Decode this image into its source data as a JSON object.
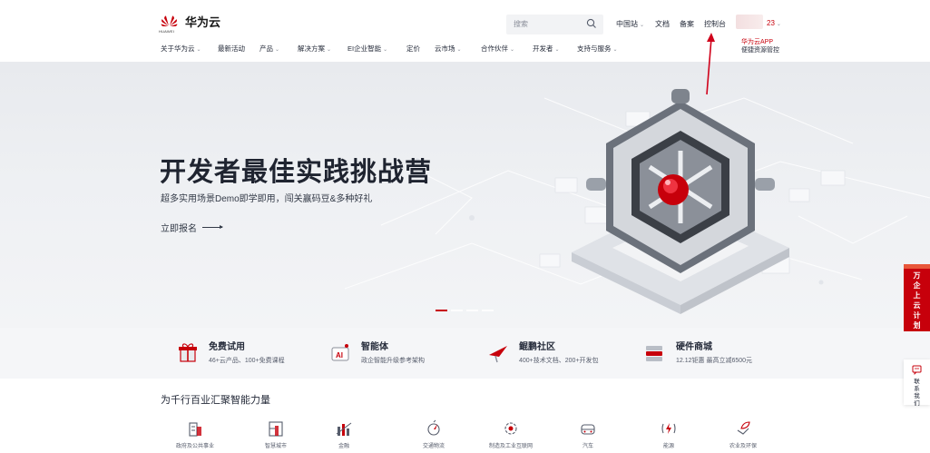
{
  "header": {
    "logo_text": "华为云",
    "logo_sub": "HUAWEI",
    "search_placeholder": "搜索",
    "top_links": {
      "region": "中国站",
      "docs": "文档",
      "filing": "备案",
      "console": "控制台",
      "user_suffix": "23"
    },
    "app_promo": {
      "line1": "华为云APP",
      "line2": "便捷资源管控"
    }
  },
  "nav": [
    {
      "label": "关于华为云",
      "dropdown": true
    },
    {
      "label": "最新活动",
      "dropdown": false
    },
    {
      "label": "产品",
      "dropdown": true
    },
    {
      "label": "解决方案",
      "dropdown": true
    },
    {
      "label": "EI企业智能",
      "dropdown": true
    },
    {
      "label": "定价",
      "dropdown": false
    },
    {
      "label": "云市场",
      "dropdown": true
    },
    {
      "label": "合作伙伴",
      "dropdown": true
    },
    {
      "label": "开发者",
      "dropdown": true
    },
    {
      "label": "支持与服务",
      "dropdown": true
    }
  ],
  "hero": {
    "title": "开发者最佳实践挑战营",
    "subtitle": "超多实用场景Demo即学即用，闯关赢码豆&多种好礼",
    "cta": "立即报名",
    "slides_total": 4,
    "slide_active": 1
  },
  "features": [
    {
      "title": "免费试用",
      "desc": "46+云产品、100+免费课程",
      "icon": "gift-icon"
    },
    {
      "title": "智能体",
      "desc": "政企智能升级参考架构",
      "icon": "ai-icon"
    },
    {
      "title": "鲲鹏社区",
      "desc": "400+技术文档、200+开发包",
      "icon": "kunpeng-icon"
    },
    {
      "title": "硬件商城",
      "desc": "12.12钜惠 最高立减6500元",
      "icon": "hardware-icon"
    }
  ],
  "side": {
    "plan_text": "万企上云计划",
    "contact_text": "联系我们"
  },
  "industries": {
    "title": "为千行百业汇聚智能力量",
    "items": [
      {
        "label": "政府及公共事业",
        "icon": "government-icon"
      },
      {
        "label": "智慧城市",
        "icon": "smart-city-icon"
      },
      {
        "label": "金融",
        "icon": "finance-icon"
      },
      {
        "label": "交通物流",
        "icon": "logistics-icon"
      },
      {
        "label": "制造及工业互联网",
        "icon": "manufacturing-icon"
      },
      {
        "label": "汽车",
        "icon": "car-icon"
      },
      {
        "label": "能源",
        "icon": "energy-icon"
      },
      {
        "label": "农业及环保",
        "icon": "agriculture-icon"
      }
    ]
  },
  "colors": {
    "brand_red": "#c7000b",
    "text": "#252b3a",
    "muted": "#575d6c"
  }
}
